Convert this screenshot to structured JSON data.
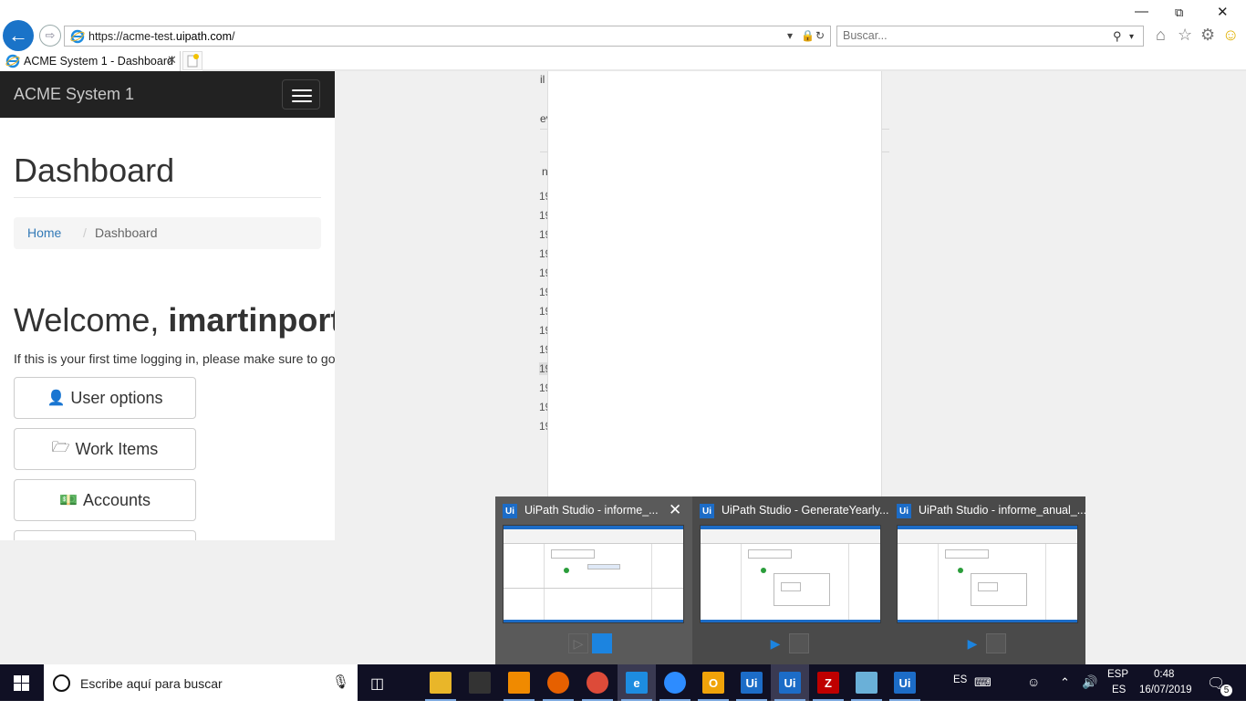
{
  "browser": {
    "url_prefix": "https://acme-test.",
    "url_domain": "uipath.com",
    "url_suffix": "/",
    "search_placeholder": "Buscar...",
    "tab_title": "ACME System 1 - Dashboard"
  },
  "acme": {
    "brand": "ACME System 1",
    "page_title": "Dashboard",
    "breadcrumb_home": "Home",
    "breadcrumb_sep": "/",
    "breadcrumb_current": "Dashboard",
    "welcome_prefix": "Welcome, ",
    "welcome_user": "imartinport",
    "intro_text": "If this is your first time logging in, please make sure to go",
    "buttons": [
      {
        "label": "User options",
        "icon": "user-icon"
      },
      {
        "label": "Work Items",
        "icon": "folder-open-icon"
      },
      {
        "label": "Accounts",
        "icon": "money-icon"
      }
    ]
  },
  "background_window": {
    "fragments": [
      "il",
      "ev",
      "n"
    ],
    "row_prefix": [
      "19",
      "19",
      "19",
      "19",
      "19",
      "19",
      "19",
      "19",
      "19",
      "19",
      "19",
      "19",
      "19"
    ]
  },
  "thumbnails": [
    {
      "title": "UiPath Studio - informe_...",
      "icon": "Ui"
    },
    {
      "title": "UiPath Studio - GenerateYearly...",
      "icon": "Ui"
    },
    {
      "title": "UiPath Studio - informe_anual_...",
      "icon": "Ui"
    }
  ],
  "taskbar": {
    "search_text": "Escribe aquí para buscar",
    "lang_top": "ESP",
    "lang_bottom": "ES",
    "input_lang": "ES",
    "time": "0:48",
    "date": "16/07/2019",
    "notifications": "5",
    "apps": [
      {
        "name": "file-explorer",
        "label": "",
        "color": "#e9b629"
      },
      {
        "name": "calculator",
        "label": "",
        "color": "#333"
      },
      {
        "name": "vlc",
        "label": "",
        "color": "#f08a00"
      },
      {
        "name": "firefox",
        "label": "",
        "color": "#e66000"
      },
      {
        "name": "chrome",
        "label": "",
        "color": "#dd4b39"
      },
      {
        "name": "internet-explorer",
        "label": "e",
        "color": "#1d8ce0"
      },
      {
        "name": "zoom",
        "label": "",
        "color": "#2d8cff"
      },
      {
        "name": "outlook",
        "label": "O",
        "color": "#f0a30a"
      },
      {
        "name": "uipath-1",
        "label": "Ui",
        "color": "#1c6cc7"
      },
      {
        "name": "uipath-2",
        "label": "Ui",
        "color": "#1c6cc7"
      },
      {
        "name": "filezilla",
        "label": "Z",
        "color": "#bf0000"
      },
      {
        "name": "notes",
        "label": "",
        "color": "#6ab0d8"
      },
      {
        "name": "uipath-3",
        "label": "Ui",
        "color": "#1c6cc7"
      }
    ]
  }
}
